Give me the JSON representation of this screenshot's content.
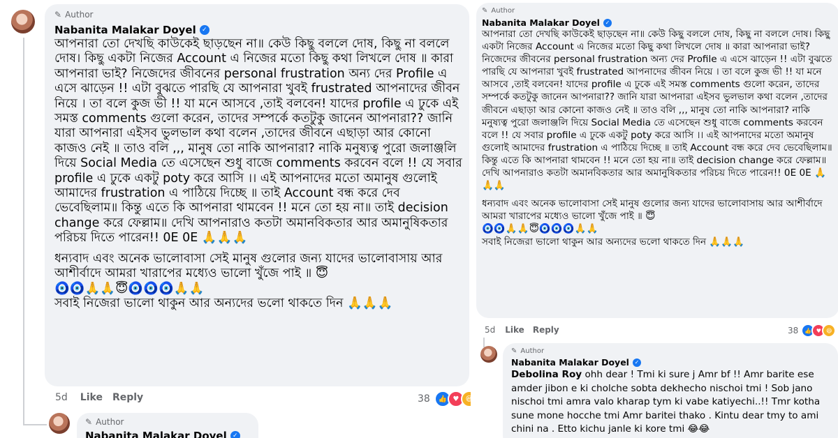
{
  "left": {
    "author_badge": "Author",
    "author_name": "Nabanita Malakar Doyel",
    "comment_paragraph_1": "আপনারা তো দেখছি কাউকেই ছাড়ছেন না॥ কেউ কিছু বললে দোষ, কিছু না বললে দোষ। কিছু একটা নিজের Account এ নিজের মতো কিছু কথা লিখলে দোষ ॥ কারা আপনারা ভাই? নিজেদের জীবনের personal frustration অন্য দের Profile এ এসে ঝাড়েন !! এটা বুঝতে পারছি যে আপনারা খুবই frustrated আপনাদের জীবন নিয়ে । তা বলে কুজ ভী !! যা মনে আসবে ,তাই বলবেন! যাদের profile এ ঢুকে এই সমস্ত comments গুলো করেন, তাদের সম্পর্কে কতটুকু জানেন আপনারা?? জানি যারা আপনারা এইসব ভুলভাল কথা বলেন ,তাদের জীবনে এছাড়া আর কোনো কাজও নেই ॥ তাও বলি ,,, মানুষ তো নাকি আপনারা? নাকি মনুষ্যত্ব পুরো জলাঞ্জলি দিয়ে Social Media তে এসেছেন শুধু বাজে comments করবেন বলে !! যে সবার profile এ ঢুকে একটু poty করে আসি ।। এই আপনাদের মতো অমানুষ গুলোই আমাদের frustration এ পাঠিয়ে দিচ্ছে ॥ তাই Account বন্ধ করে দেব ভেবেছিলাম॥ কিন্তু এতে কি আপনারা থামবেন !! মনে তো হয় না॥ তাই decision change করে ফেল্লাম॥ দেখি আপনারাও কতটা অমানবিকতার আর অমানুষিকতার পরিচয় দিতে পারেন!! 0E 0E 🙏🙏🙏",
    "comment_paragraph_2": "ধন্যবাদ এবং অনেক ভালোবাসা সেই মানুষ গুলোর জন্য যাদের ভালোবাসায় আর আশীর্বাদে আমরা খারাপের মধ্যেও ভালো খুঁজে পাই ॥ 😇",
    "comment_emoji_line": "🧿🧿🙏🙏😇🧿🧿🧿🙏🙏",
    "comment_paragraph_3": "সবাই নিজেরা ভালো থাকুন আর অন্যদের ভলো থাকতে দিন 🙏🙏🙏",
    "time": "5d",
    "like_label": "Like",
    "reply_label": "Reply",
    "reaction_count": "38",
    "reply_author_badge": "Author",
    "reply_author_name": "Nabanita Malakar Doyel"
  },
  "right": {
    "author_badge": "Author",
    "author_name": "Nabanita Malakar Doyel",
    "comment_paragraph_1": "আপনারা তো দেখছি কাউকেই ছাড়ছেন না॥ কেউ কিছু বললে দোষ, কিছু না বললে দোষ। কিছু একটা নিজের Account এ নিজের মতো কিছু কথা লিখলে দোষ ॥ কারা আপনারা ভাই? নিজেদের জীবনের personal frustration অন্য দের Profile এ এসে ঝাড়েন !! এটা বুঝতে পারছি যে আপনারা খুবই frustrated আপনাদের জীবন নিয়ে । তা বলে কুজ ভী !! যা মনে আসবে ,তাই বলবেন! যাদের profile এ ঢুকে এই সমস্ত comments গুলো করেন, তাদের সম্পর্কে কতটুকু জানেন আপনারা?? জানি যারা আপনারা এইসব ভুলভাল কথা বলেন ,তাদের জীবনে এছাড়া আর কোনো কাজও নেই ॥ তাও বলি ,,, মানুষ তো নাকি আপনারা? নাকি মনুষ্যত্ব পুরো জলাঞ্জলি দিয়ে Social Media তে এসেছেন শুধু বাজে comments করবেন বলে !! যে সবার profile এ ঢুকে একটু poty করে আসি ।। এই আপনাদের মতো অমানুষ গুলোই আমাদের frustration এ পাঠিয়ে দিচ্ছে ॥ তাই Account বন্ধ করে দেব ভেবেছিলাম॥ কিন্তু এতে কি আপনারা থামবেন !! মনে তো হয় না॥ তাই decision change করে ফেল্লাম॥ দেখি আপনারাও কতটা অমানবিকতার আর অমানুষিকতার পরিচয় দিতে পারেন!! 0E 0E 🙏🙏🙏",
    "comment_paragraph_2": "ধন্যবাদ এবং অনেক ভালোবাসা সেই মানুষ গুলোর জন্য যাদের ভালোবাসায় আর আশীর্বাদে আমরা খারাপের মধ্যেও ভালো খুঁজে পাই ॥ 😇",
    "comment_emoji_line": "🧿🧿🙏🙏😇🧿🧿🧿🙏🙏",
    "comment_paragraph_3": "সবাই নিজেরা ভালো থাকুন আর অন্যদের ভলো থাকতে দিন 🙏🙏🙏",
    "time": "5d",
    "like_label": "Like",
    "reply_label": "Reply",
    "reaction_count": "38",
    "reply_author_badge": "Author",
    "reply_author_name": "Nabanita Malakar Doyel",
    "reply_mention": "Debolina Roy",
    "reply_text": " ohh dear ! Tmi ki sure j Amr bf !! Amr barite ese amder jibon e ki cholche sobta dekhecho nischoi tmi ! Sob jano nischoi tmi amra valo kharap tym ki vabe katiyechi..!! Tmr kotha sune mone hocche tmi Amr baritei thako . Kintu dear tmy to ami chini na . Etto kichu janle ki kore tmi 😂😂"
  },
  "icons": {
    "pen": "pencil-icon",
    "verified": "verified-badge-icon",
    "like_reaction": "thumbs-up-icon",
    "love_reaction": "heart-icon",
    "haha_reaction": "laughing-face-icon"
  },
  "colors": {
    "bubble": "#f0f2f5",
    "meta": "#65676b",
    "facebook_blue": "#1877f2",
    "love_red": "#f33e58",
    "haha_yellow": "#f7b125"
  }
}
